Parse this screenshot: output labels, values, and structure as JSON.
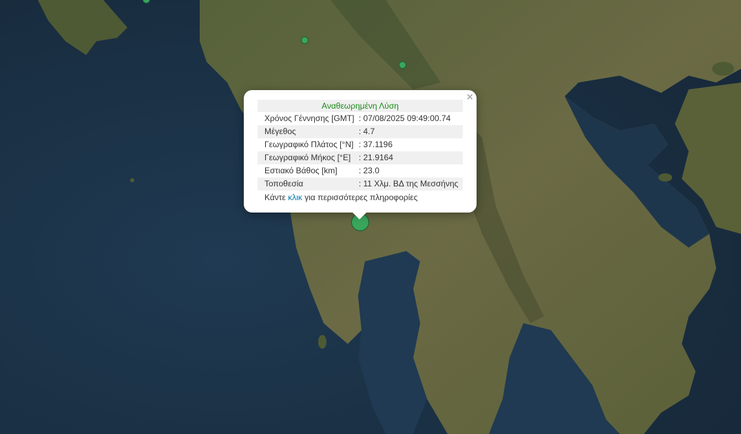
{
  "popup": {
    "title": "Αναθεωρημένη Λύση",
    "close_icon": "×",
    "rows": [
      {
        "label": "Χρόνος Γέννησης [GMT]",
        "value": ": 07/08/2025 09:49:00.74"
      },
      {
        "label": "Μέγεθος",
        "value": ": 4.7"
      },
      {
        "label": "Γεωγραφικό Πλάτος [°N]",
        "value": ": 37.1196"
      },
      {
        "label": "Γεωγραφικό Μήκος [°E]",
        "value": ": 21.9164"
      },
      {
        "label": "Εστιακό Βάθος [km]",
        "value": ": 23.0"
      },
      {
        "label": "Τοποθεσία",
        "value": ": 11 Χλμ. ΒΔ της Μεσσήνης"
      }
    ],
    "more_prefix": "Κάντε ",
    "more_link": "κλικ",
    "more_suffix": " για περισσότερες πληροφορίες"
  },
  "colors": {
    "sea": "#1d3347",
    "land": "#5d6a3e",
    "marker": "#3aa65c",
    "title_green": "#1a8a1a",
    "link": "#0078a8"
  }
}
